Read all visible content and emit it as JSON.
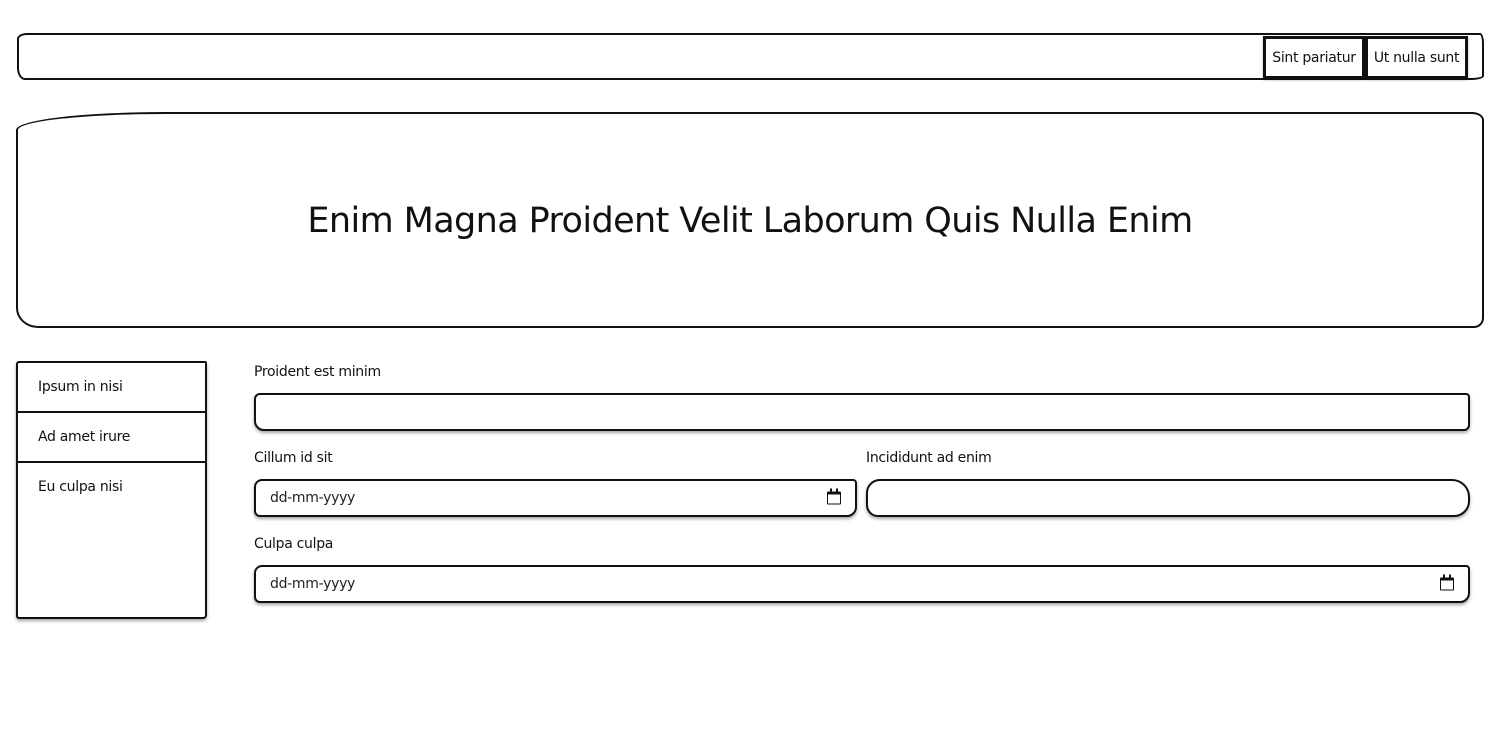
{
  "navbar": {
    "buttons": [
      "Sint pariatur",
      "Ut nulla sunt"
    ]
  },
  "hero": {
    "title": "Enim Magna Proident Velit Laborum Quis Nulla Enim"
  },
  "sidebar": {
    "items": [
      "Ipsum in nisi",
      "Ad amet irure",
      "Eu culpa nisi"
    ]
  },
  "form": {
    "field1": {
      "label": "Proident est minim",
      "value": ""
    },
    "field2": {
      "label": "Cillum id sit",
      "placeholder": "dd-mm-yyyy"
    },
    "field3": {
      "label": "Incididunt ad enim",
      "value": ""
    },
    "field4": {
      "label": "Culpa culpa",
      "placeholder": "dd-mm-yyyy"
    }
  },
  "icons": {
    "date_picker": "calendar-icon"
  }
}
